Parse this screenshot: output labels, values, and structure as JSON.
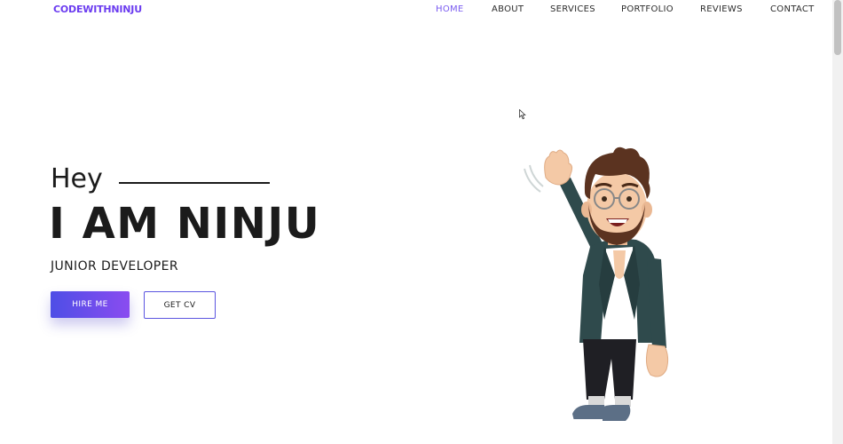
{
  "nav": {
    "logo": "CODEWITHNINJU",
    "items": [
      {
        "label": "HOME",
        "active": true
      },
      {
        "label": "ABOUT",
        "active": false
      },
      {
        "label": "SERVICES",
        "active": false
      },
      {
        "label": "PORTFOLIO",
        "active": false
      },
      {
        "label": "REVIEWS",
        "active": false
      },
      {
        "label": "CONTACT",
        "active": false
      }
    ]
  },
  "hero": {
    "greeting": "Hey",
    "title": "I AM NINJU",
    "subtitle": "JUNIOR DEVELOPER",
    "primary_button": "HIRE ME",
    "secondary_button": "GET CV"
  },
  "colors": {
    "accent": "#7a5cf0",
    "logo": "#6b3cf0",
    "button_gradient_start": "#4e4ee6",
    "button_gradient_end": "#8a4cf0",
    "text": "#1b1b1b"
  },
  "icons": {
    "avatar": "waving-man-avatar-illustration",
    "cursor": "mouse-pointer-icon"
  }
}
